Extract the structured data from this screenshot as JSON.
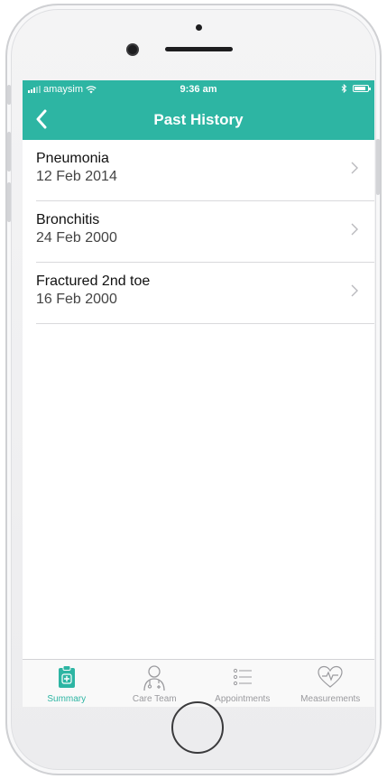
{
  "status_bar": {
    "carrier": "amaysim",
    "time": "9:36 am",
    "battery_level": 0.85
  },
  "nav": {
    "title": "Past History",
    "back_icon": "chevron-left-icon"
  },
  "history": [
    {
      "name": "Pneumonia",
      "date": "12 Feb 2014"
    },
    {
      "name": "Bronchitis",
      "date": "24 Feb 2000"
    },
    {
      "name": "Fractured 2nd toe",
      "date": "16 Feb 2000"
    }
  ],
  "tabs": [
    {
      "label": "Summary",
      "icon": "clipboard-medical-icon",
      "active": true
    },
    {
      "label": "Care Team",
      "icon": "doctor-icon",
      "active": false
    },
    {
      "label": "Appointments",
      "icon": "list-icon",
      "active": false
    },
    {
      "label": "Measurements",
      "icon": "heart-rate-icon",
      "active": false
    }
  ],
  "colors": {
    "accent": "#2db5a3",
    "inactive_tab": "#9a9a9e",
    "separator": "#d9d9dc"
  }
}
